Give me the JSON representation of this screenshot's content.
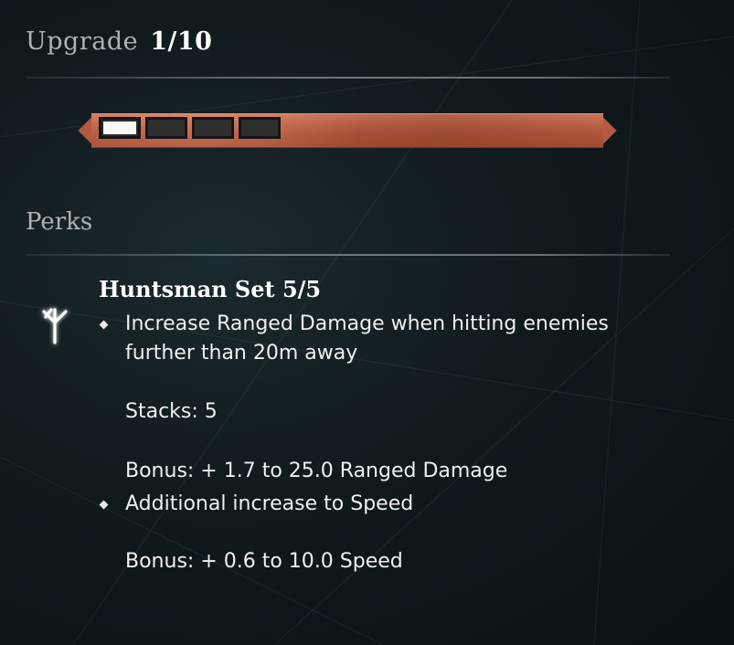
{
  "upgrade": {
    "label": "Upgrade",
    "level": "1/10",
    "current": 1,
    "max": 10
  },
  "upgrade_bar": {
    "filled_pips": 1,
    "total_pips": 4,
    "bar_color": "#b45a40"
  },
  "perks": {
    "title": "Perks",
    "set_name": "Huntsman Set 5/5",
    "icon": "rune-icon",
    "lines": [
      "Increase Ranged Damage when hitting enemies",
      "further than 20m away",
      "Stacks: 5",
      "Bonus: + 1.7 to 25.0 Ranged Damage",
      "Additional increase to Speed",
      "Bonus: + 0.6 to 10.0 Speed"
    ]
  }
}
